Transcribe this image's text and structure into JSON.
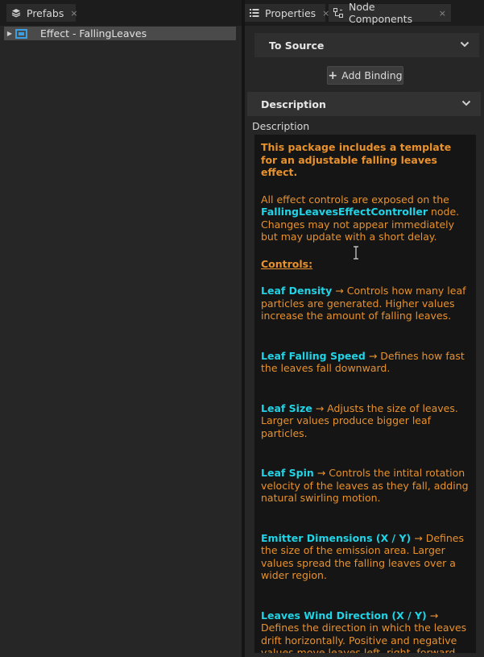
{
  "left_panel": {
    "tab": {
      "label": "Prefabs",
      "icon": "layers-icon",
      "close": "×"
    },
    "tree": [
      {
        "label": "Effect - FallingLeaves",
        "icon": "effect-icon",
        "expanded": false
      }
    ]
  },
  "right_panel": {
    "tabs": [
      {
        "label": "Properties",
        "icon": "list-icon",
        "close": "×",
        "active": false
      },
      {
        "label": "Node Components",
        "icon": "components-icon",
        "close": "×",
        "active": true
      }
    ],
    "to_source_header": "To Source",
    "add_binding_label": "Add Binding",
    "add_binding_plus": "+",
    "description_header": "Description",
    "description_label": "Description",
    "description": {
      "intro_bold": "This package includes a template for an adjustable falling leaves effect.",
      "p1_a": "All effect controls are exposed on the ",
      "p1_node": "FallingLeavesEffectController",
      "p1_b": " node. Changes may not appear immediately but may update with a short delay.",
      "controls_heading": "Controls:",
      "arrow": "→",
      "items": [
        {
          "name": "Leaf Density",
          "text": " Controls how many leaf particles are generated. Higher values increase the amount of falling leaves."
        },
        {
          "name": "Leaf Falling Speed",
          "text": " Defines how fast the leaves fall downward."
        },
        {
          "name": "Leaf Size",
          "text": " Adjusts the size of  leaves. Larger values produce bigger leaf particles."
        },
        {
          "name": "Leaf Spin",
          "text": " Controls the intital rotation velocity of the leaves as they fall, adding natural swirling motion."
        },
        {
          "name": "Emitter Dimensions (X / Y)",
          "text": " Defines the size of the emission area. Larger values spread the falling leaves over a wider region."
        },
        {
          "name": "Leaves Wind Direction (X / Y)",
          "text": " Defines the direction in which the leaves drift horizontally. Positive and negative values move leaves left, right, forward, or backward depending on axis direction."
        }
      ]
    }
  },
  "colors": {
    "background": "#262626",
    "text_orange": "#e8912d",
    "text_cyan": "#21d3e6",
    "selection": "#4a4a4a",
    "effect_icon": "#3aa0e6"
  }
}
